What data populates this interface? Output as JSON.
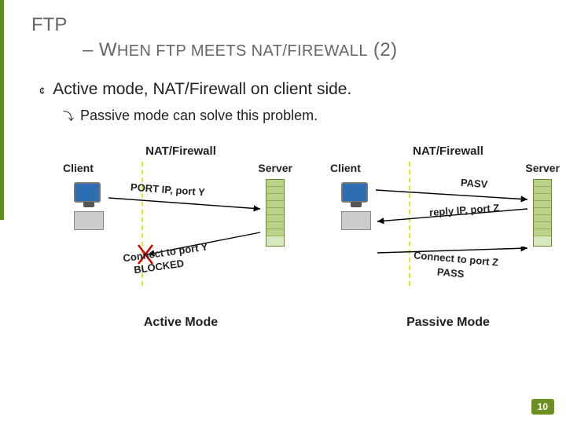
{
  "title_line1": "FTP",
  "title_line2_prefix": "– W",
  "title_line2_rest": "HEN FTP MEETS NAT/F",
  "title_line2_tail": "IREWALL",
  "title_line2_suffix": " (2)",
  "bullet1": "Active mode, NAT/Firewall on client side.",
  "bullet2": "Passive mode can solve this problem.",
  "bullet1_glyph": "¢",
  "bullet2_glyph": "⤵",
  "left": {
    "title": "NAT/Firewall",
    "client": "Client",
    "server": "Server",
    "msg1": "PORT IP, port Y",
    "msg2a": "Connect to port Y",
    "msg2b": "BLOCKED",
    "caption": "Active Mode"
  },
  "right": {
    "title": "NAT/Firewall",
    "client": "Client",
    "server": "Server",
    "msg1": "PASV",
    "msg2": "reply IP, port Z",
    "msg3a": "Connect to port Z",
    "msg3b": "PASS",
    "caption": "Passive Mode"
  },
  "page_number": "10"
}
